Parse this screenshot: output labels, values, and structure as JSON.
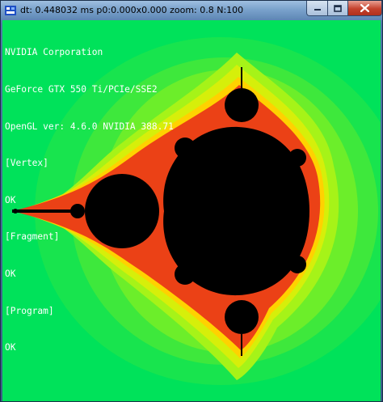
{
  "window": {
    "title": "dt: 0.448032 ms p0:0.000x0.000 zoom: 0.8 N:100",
    "icon": "app-icon",
    "buttons": {
      "minimize": "minimize-icon",
      "maximize": "maximize-icon",
      "close": "close-icon"
    }
  },
  "console": {
    "lines": [
      "NVIDIA Corporation",
      "GeForce GTX 550 Ti/PCIe/SSE2",
      "OpenGL ver: 4.6.0 NVIDIA 388.71",
      "[Vertex]",
      "OK",
      "[Fragment]",
      "OK",
      "[Program]",
      "OK"
    ]
  },
  "colors": {
    "background_green": "#00e25a",
    "set_interior": "#000000",
    "boundary_red": "#e8201a",
    "boundary_yellow": "#ffe600",
    "text": "#ffffff"
  }
}
